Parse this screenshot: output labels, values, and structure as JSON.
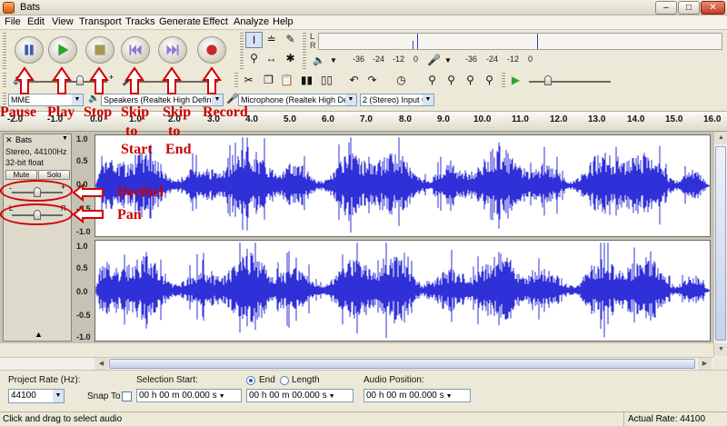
{
  "window": {
    "title": "Bats"
  },
  "menu": [
    "File",
    "Edit",
    "View",
    "Transport",
    "Tracks",
    "Generate",
    "Effect",
    "Analyze",
    "Help"
  ],
  "meters": {
    "play_l": "L",
    "play_r": "R",
    "scale": [
      "-36",
      "-24",
      "-12",
      "0"
    ],
    "rec_scale": [
      "-36",
      "-24",
      "-12",
      "0"
    ],
    "row2_scale": [
      "-36",
      "-24",
      "-12",
      "0"
    ]
  },
  "device": {
    "host": "MME",
    "output": "Speakers (Realtek High Definit",
    "input": "Microphone (Realtek High Defi",
    "channels": "2 (Stereo) Input C"
  },
  "mixer": {
    "plus": "+",
    "minus": "-"
  },
  "ruler": [
    "-2.0",
    "-1.0",
    "0.0",
    "1.0",
    "2.0",
    "3.0",
    "4.0",
    "5.0",
    "6.0",
    "7.0",
    "8.0",
    "9.0",
    "10.0",
    "11.0",
    "12.0",
    "13.0",
    "14.0",
    "15.0",
    "16.0"
  ],
  "track": {
    "name": "Bats",
    "format": "Stereo, 44100Hz",
    "bits": "32-bit float",
    "mute": "Mute",
    "solo": "Solo",
    "gain_minus": "-",
    "gain_plus": "+",
    "pan_l": "L",
    "pan_r": "R",
    "amp_top": [
      "1.0",
      "0.5",
      "0.0",
      "-0.5",
      "-1.0"
    ],
    "amp_bottom": [
      "1.0",
      "0.5",
      "0.0",
      "-0.5",
      "-1.0"
    ]
  },
  "selection": {
    "project_rate_label": "Project Rate (Hz):",
    "project_rate": "44100",
    "snap_to": "Snap To",
    "start_label": "Selection Start:",
    "end_label": "End",
    "length_label": "Length",
    "audio_position_label": "Audio Position:",
    "start_time": "00 h 00 m 00.000 s",
    "end_time": "00 h 00 m 00.000 s",
    "audio_position": "00 h 00 m 00.000 s"
  },
  "status": {
    "left": "Click and drag to select audio",
    "right": "Actual Rate: 44100"
  },
  "annotations": {
    "pause": "Pause",
    "play": "Play",
    "stop": "Stop",
    "skip_start_1": "Skip",
    "skip_start_2": "to",
    "skip_start_3": "Start",
    "skip_end_1": "Skip",
    "skip_end_2": "to",
    "skip_end_3": "End",
    "record": "Record",
    "decibel": "Decibel",
    "pan": "Pan"
  },
  "colors": {
    "waveform": "#3030d8",
    "annotation": "#c80000",
    "play_green": "#2da52d",
    "record_red": "#c82828"
  }
}
